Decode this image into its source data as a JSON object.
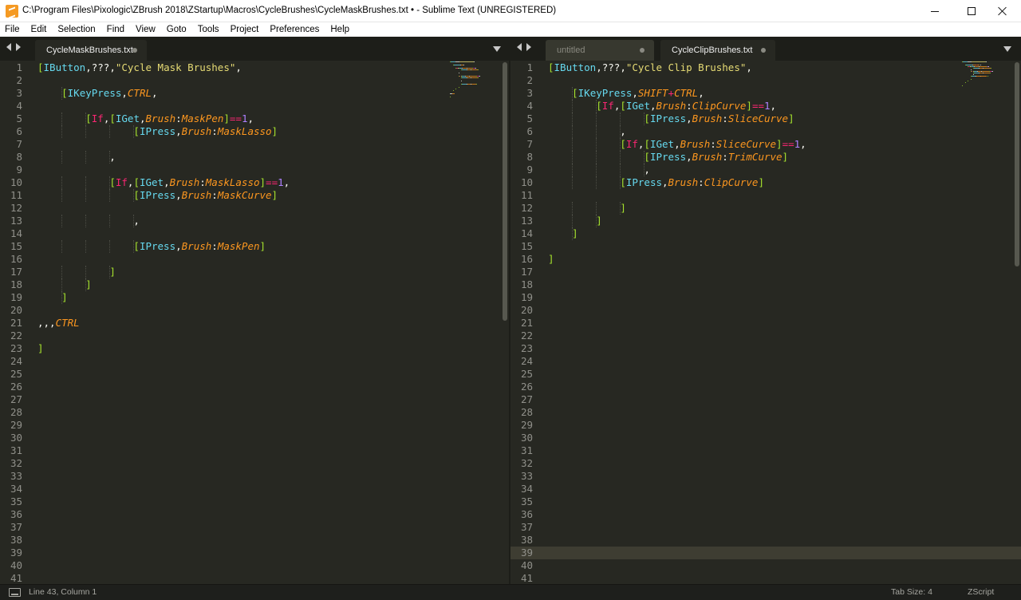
{
  "window": {
    "title": "C:\\Program Files\\Pixologic\\ZBrush 2018\\ZStartup\\Macros\\CycleBrushes\\CycleMaskBrushes.txt • - Sublime Text (UNREGISTERED)"
  },
  "menu": [
    "File",
    "Edit",
    "Selection",
    "Find",
    "View",
    "Goto",
    "Tools",
    "Project",
    "Preferences",
    "Help"
  ],
  "colors": {
    "bg": "#272822",
    "bracket": "#a6e22e",
    "keyword": "#f92672",
    "func": "#66d9ef",
    "italic_ident": "#fd971f",
    "string": "#e6db74",
    "number": "#ae81ff",
    "plain": "#f8f8f2"
  },
  "left_pane": {
    "tabs": [
      {
        "label": "CycleMaskBrushes.txt",
        "active": true
      }
    ],
    "line_count": 41,
    "lines": [
      [
        [
          "b",
          "["
        ],
        [
          "f",
          "IButton"
        ],
        [
          "p",
          ",???,"
        ],
        [
          "s",
          "\"Cycle Mask Brushes\""
        ],
        [
          "p",
          ","
        ]
      ],
      [],
      [
        [
          "p",
          "    "
        ],
        [
          "b",
          "["
        ],
        [
          "f",
          "IKeyPress"
        ],
        [
          "p",
          ","
        ],
        [
          "o",
          "CTRL"
        ],
        [
          "p",
          ","
        ]
      ],
      [],
      [
        [
          "p",
          "        "
        ],
        [
          "b",
          "["
        ],
        [
          "k",
          "If"
        ],
        [
          "p",
          ","
        ],
        [
          "b",
          "["
        ],
        [
          "f",
          "IGet"
        ],
        [
          "p",
          ","
        ],
        [
          "o",
          "Brush"
        ],
        [
          "p",
          ":"
        ],
        [
          "o",
          "MaskPen"
        ],
        [
          "b",
          "]"
        ],
        [
          "k",
          "=="
        ],
        [
          "n",
          "1"
        ],
        [
          "p",
          ","
        ]
      ],
      [
        [
          "p",
          "                "
        ],
        [
          "b",
          "["
        ],
        [
          "f",
          "IPress"
        ],
        [
          "p",
          ","
        ],
        [
          "o",
          "Brush"
        ],
        [
          "p",
          ":"
        ],
        [
          "o",
          "MaskLasso"
        ],
        [
          "b",
          "]"
        ]
      ],
      [],
      [
        [
          "p",
          "            ,"
        ]
      ],
      [],
      [
        [
          "p",
          "            "
        ],
        [
          "b",
          "["
        ],
        [
          "k",
          "If"
        ],
        [
          "p",
          ","
        ],
        [
          "b",
          "["
        ],
        [
          "f",
          "IGet"
        ],
        [
          "p",
          ","
        ],
        [
          "o",
          "Brush"
        ],
        [
          "p",
          ":"
        ],
        [
          "o",
          "MaskLasso"
        ],
        [
          "b",
          "]"
        ],
        [
          "k",
          "=="
        ],
        [
          "n",
          "1"
        ],
        [
          "p",
          ","
        ]
      ],
      [
        [
          "p",
          "                "
        ],
        [
          "b",
          "["
        ],
        [
          "f",
          "IPress"
        ],
        [
          "p",
          ","
        ],
        [
          "o",
          "Brush"
        ],
        [
          "p",
          ":"
        ],
        [
          "o",
          "MaskCurve"
        ],
        [
          "b",
          "]"
        ]
      ],
      [],
      [
        [
          "p",
          "                ,"
        ]
      ],
      [],
      [
        [
          "p",
          "                "
        ],
        [
          "b",
          "["
        ],
        [
          "f",
          "IPress"
        ],
        [
          "p",
          ","
        ],
        [
          "o",
          "Brush"
        ],
        [
          "p",
          ":"
        ],
        [
          "o",
          "MaskPen"
        ],
        [
          "b",
          "]"
        ]
      ],
      [],
      [
        [
          "p",
          "            "
        ],
        [
          "b",
          "]"
        ]
      ],
      [
        [
          "p",
          "        "
        ],
        [
          "b",
          "]"
        ]
      ],
      [
        [
          "p",
          "    "
        ],
        [
          "b",
          "]"
        ]
      ],
      [],
      [
        [
          "p",
          ",,,"
        ],
        [
          "o",
          "CTRL"
        ]
      ],
      [],
      [
        [
          "b",
          "]"
        ]
      ]
    ]
  },
  "right_pane": {
    "tabs": [
      {
        "label": "untitled",
        "active": false
      },
      {
        "label": "CycleClipBrushes.txt",
        "active": true
      }
    ],
    "line_count": 41,
    "highlight_line": 39,
    "lines": [
      [
        [
          "b",
          "["
        ],
        [
          "f",
          "IButton"
        ],
        [
          "p",
          ",???,"
        ],
        [
          "s",
          "\"Cycle Clip Brushes\""
        ],
        [
          "p",
          ","
        ]
      ],
      [],
      [
        [
          "p",
          "    "
        ],
        [
          "b",
          "["
        ],
        [
          "f",
          "IKeyPress"
        ],
        [
          "p",
          ","
        ],
        [
          "o",
          "SHIFT"
        ],
        [
          "k",
          "+"
        ],
        [
          "o",
          "CTRL"
        ],
        [
          "p",
          ","
        ]
      ],
      [
        [
          "p",
          "        "
        ],
        [
          "b",
          "["
        ],
        [
          "k",
          "If"
        ],
        [
          "p",
          ","
        ],
        [
          "b",
          "["
        ],
        [
          "f",
          "IGet"
        ],
        [
          "p",
          ","
        ],
        [
          "o",
          "Brush"
        ],
        [
          "p",
          ":"
        ],
        [
          "o",
          "ClipCurve"
        ],
        [
          "b",
          "]"
        ],
        [
          "k",
          "=="
        ],
        [
          "n",
          "1"
        ],
        [
          "p",
          ","
        ]
      ],
      [
        [
          "p",
          "                "
        ],
        [
          "b",
          "["
        ],
        [
          "f",
          "IPress"
        ],
        [
          "p",
          ","
        ],
        [
          "o",
          "Brush"
        ],
        [
          "p",
          ":"
        ],
        [
          "o",
          "SliceCurve"
        ],
        [
          "b",
          "]"
        ]
      ],
      [
        [
          "p",
          "            ,"
        ]
      ],
      [
        [
          "p",
          "            "
        ],
        [
          "b",
          "["
        ],
        [
          "k",
          "If"
        ],
        [
          "p",
          ","
        ],
        [
          "b",
          "["
        ],
        [
          "f",
          "IGet"
        ],
        [
          "p",
          ","
        ],
        [
          "o",
          "Brush"
        ],
        [
          "p",
          ":"
        ],
        [
          "o",
          "SliceCurve"
        ],
        [
          "b",
          "]"
        ],
        [
          "k",
          "=="
        ],
        [
          "n",
          "1"
        ],
        [
          "p",
          ","
        ]
      ],
      [
        [
          "p",
          "                "
        ],
        [
          "b",
          "["
        ],
        [
          "f",
          "IPress"
        ],
        [
          "p",
          ","
        ],
        [
          "o",
          "Brush"
        ],
        [
          "p",
          ":"
        ],
        [
          "o",
          "TrimCurve"
        ],
        [
          "b",
          "]"
        ]
      ],
      [
        [
          "p",
          "                ,"
        ]
      ],
      [
        [
          "p",
          "            "
        ],
        [
          "b",
          "["
        ],
        [
          "f",
          "IPress"
        ],
        [
          "p",
          ","
        ],
        [
          "o",
          "Brush"
        ],
        [
          "p",
          ":"
        ],
        [
          "o",
          "ClipCurve"
        ],
        [
          "b",
          "]"
        ]
      ],
      [],
      [
        [
          "p",
          "            "
        ],
        [
          "b",
          "]"
        ]
      ],
      [
        [
          "p",
          "        "
        ],
        [
          "b",
          "]"
        ]
      ],
      [
        [
          "p",
          "    "
        ],
        [
          "b",
          "]"
        ]
      ],
      [],
      [
        [
          "b",
          "]"
        ]
      ]
    ]
  },
  "status": {
    "position": "Line 43, Column 1",
    "tab_size": "Tab Size: 4",
    "syntax": "ZScript"
  }
}
